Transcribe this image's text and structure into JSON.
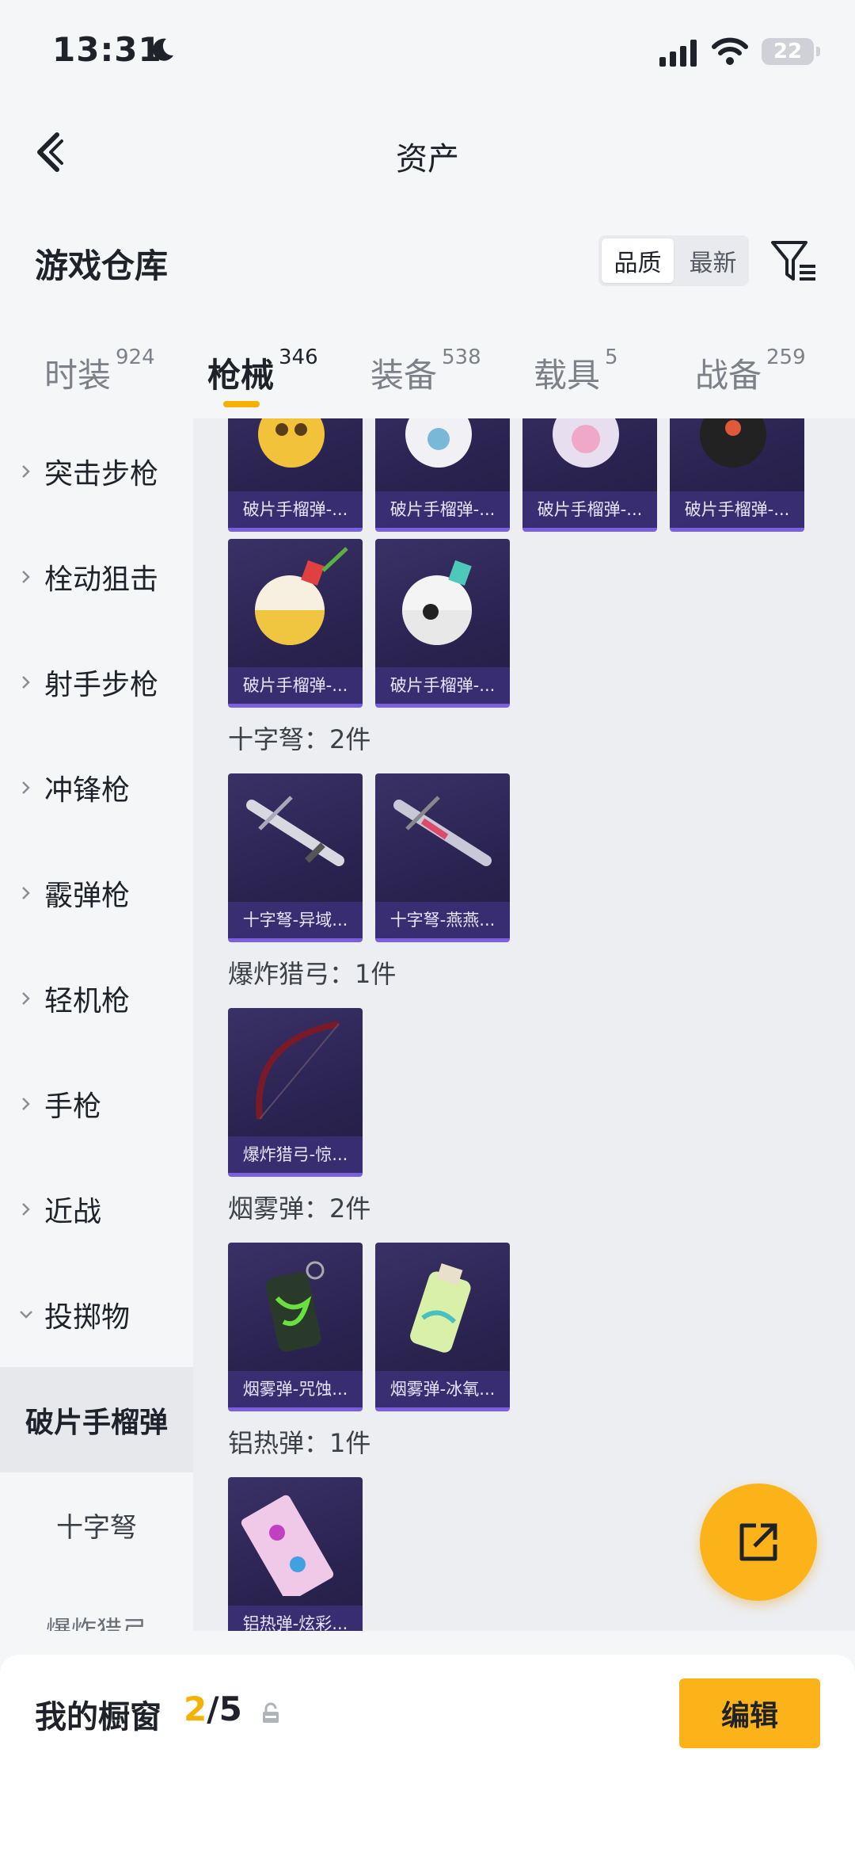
{
  "status": {
    "time": "13:31",
    "battery": "22"
  },
  "nav": {
    "title": "资产"
  },
  "section": {
    "title": "游戏仓库",
    "sort_options": [
      "品质",
      "最新"
    ]
  },
  "tabs": [
    {
      "label": "时装",
      "count": "924"
    },
    {
      "label": "枪械",
      "count": "346"
    },
    {
      "label": "装备",
      "count": "538"
    },
    {
      "label": "载具",
      "count": "5"
    },
    {
      "label": "战备",
      "count": "259"
    }
  ],
  "sidebar": {
    "items": [
      "突击步枪",
      "栓动狙击",
      "射手步枪",
      "冲锋枪",
      "霰弹枪",
      "轻机枪",
      "手枪",
      "近战",
      "投掷物"
    ],
    "sub_items": [
      "破片手榴弹",
      "十字弩",
      "爆炸猎弓"
    ]
  },
  "content": {
    "grenade_row1": [
      "破片手榴弹-...",
      "破片手榴弹-...",
      "破片手榴弹-...",
      "破片手榴弹-..."
    ],
    "grenade_row2": [
      "破片手榴弹-...",
      "破片手榴弹-..."
    ],
    "groups": [
      {
        "label": "十字弩：2件",
        "items": [
          "十字弩-异域...",
          "十字弩-燕燕..."
        ]
      },
      {
        "label": "爆炸猎弓：1件",
        "items": [
          "爆炸猎弓-惊..."
        ]
      },
      {
        "label": "烟雾弹：2件",
        "items": [
          "烟雾弹-咒蚀...",
          "烟雾弹-冰氧..."
        ]
      },
      {
        "label": "铝热弹：1件",
        "items": [
          "铝热弹-炫彩..."
        ]
      }
    ]
  },
  "bottom": {
    "title": "我的橱窗",
    "current": "2",
    "total": "/5",
    "edit": "编辑"
  },
  "colors": {
    "accent": "#fbb319",
    "card_bg": "#2a2350"
  }
}
